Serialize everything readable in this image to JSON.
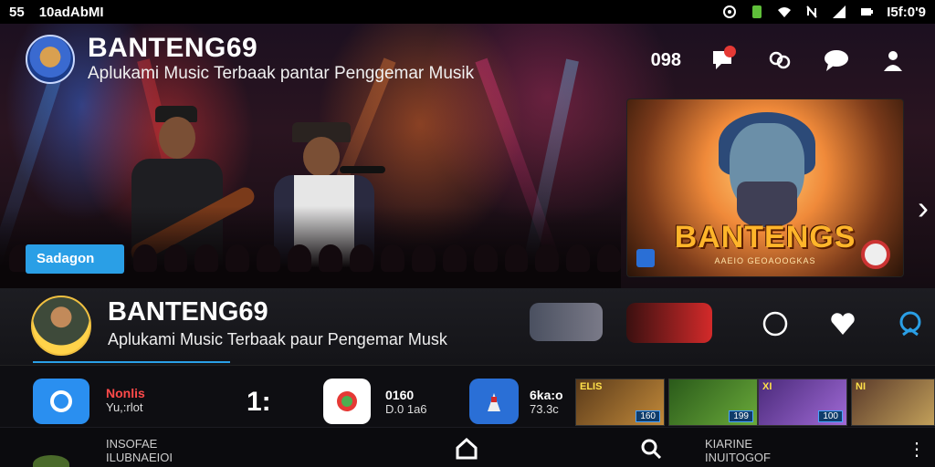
{
  "status_bar": {
    "left_time": "55",
    "left_carrier": "10adAbMI",
    "right_time": "I5f:0'9",
    "icons": [
      "shield-icon",
      "battery-saver-icon",
      "wifi-icon",
      "nfc-off-icon",
      "signal-icon",
      "battery-icon"
    ]
  },
  "header": {
    "app_name": "BANTENG69",
    "tagline": "Aplukami Music Terbaak pantar Penggemar Musik",
    "count": "098",
    "icons": [
      "chat-alert-icon",
      "link-icon",
      "messages-icon",
      "profile-icon"
    ]
  },
  "hero": {
    "tag_label": "Sadagon",
    "feature_title": "BANTENGS",
    "feature_subtitle": "AAEIO GEOAOOGKAS"
  },
  "info_row": {
    "title": "BANTENG69",
    "subtitle": "Aplukami Music Terbaak paur Pengemar Musk",
    "icons": [
      "refresh-icon",
      "heart-icon",
      "user-circle-icon"
    ]
  },
  "strip": {
    "item1_line1": "Nonlis",
    "item1_line2": "Yu,:rlot",
    "big_char": "1:",
    "item2_line1": "0160",
    "item2_line2": "D.0 1a6",
    "item3_line1": "6ka:o",
    "item3_line2": "73.3c",
    "thumbs": [
      {
        "label": "ELIS",
        "badge": "160"
      },
      {
        "label": "",
        "badge": "199"
      },
      {
        "label": "XI",
        "badge": "100"
      },
      {
        "label": "NI",
        "badge": ""
      }
    ]
  },
  "bottom_nav": {
    "left_line1": "INSOFAE",
    "left_line2": "ILUBNAEIOI",
    "right_line1": "KIARINE",
    "right_line2": "INUITOGOF",
    "more": "⋮"
  },
  "colors": {
    "accent": "#2a9fe6",
    "badge_red": "#e53935",
    "feature_gold": "#ffb52a"
  }
}
